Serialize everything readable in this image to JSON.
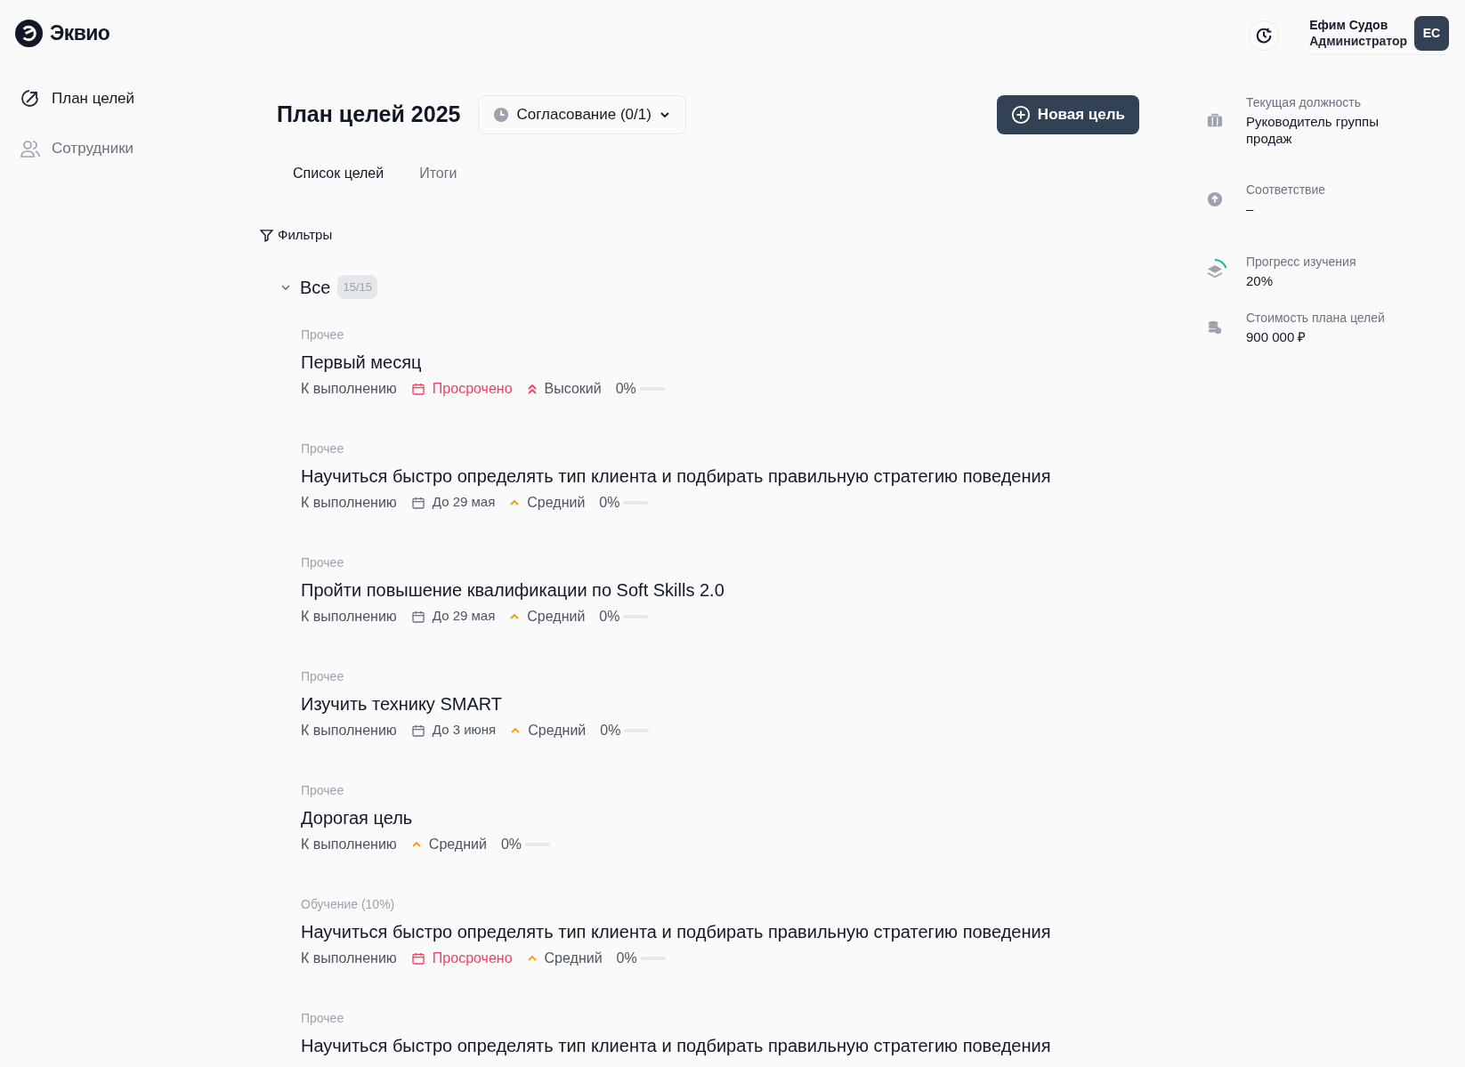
{
  "logo": {
    "text": "Эквио"
  },
  "sidebar": {
    "items": [
      {
        "label": "План целей",
        "selected": true,
        "kind": "goals"
      },
      {
        "label": "Сотрудники",
        "selected": false,
        "kind": "people"
      }
    ]
  },
  "user": {
    "name": "Ефим Судов",
    "role": "Администратор",
    "initials": "ЕС"
  },
  "page": {
    "title": "План целей 2025",
    "approval": "Согласование (0/1)",
    "new_button": "Новая цель"
  },
  "tabs": [
    {
      "label": "Список целей",
      "selected": true
    },
    {
      "label": "Итоги",
      "selected": false
    }
  ],
  "filters": "Фильтры",
  "group": {
    "label": "Все",
    "count": "15/15",
    "expanded": true
  },
  "goals": [
    {
      "category": "Прочее",
      "title": "Первый месяц",
      "status": "К выполнению",
      "deadline": {
        "text": "Просрочено",
        "overdue": true
      },
      "priority": {
        "label": "Высокий",
        "kind": "high"
      },
      "progress": "0%",
      "level": 0
    },
    {
      "category": "Прочее",
      "title": "Научиться быстро определять тип клиента и подбирать правильную стратегию поведения",
      "status": "К выполнению",
      "deadline": {
        "text": "До 29 мая",
        "overdue": false
      },
      "priority": {
        "label": "Средний",
        "kind": "medium"
      },
      "progress": "0%",
      "level": 0
    },
    {
      "category": "Прочее",
      "title": "Пройти повышение квалификации по Soft Skills 2.0",
      "status": "К выполнению",
      "deadline": {
        "text": "До 29 мая",
        "overdue": false
      },
      "priority": {
        "label": "Средний",
        "kind": "medium"
      },
      "progress": "0%",
      "level": 0
    },
    {
      "category": "Прочее",
      "title": "Изучить технику SMART",
      "status": "К выполнению",
      "deadline": {
        "text": "До 3 июня",
        "overdue": false
      },
      "priority": {
        "label": "Средний",
        "kind": "medium"
      },
      "progress": "0%",
      "level": 0
    },
    {
      "category": "Прочее",
      "title": "Дорогая цель",
      "status": "К выполнению",
      "priority": {
        "label": "Средний",
        "kind": "medium"
      },
      "progress": "0%",
      "level": 0
    },
    {
      "category": "Обучение (10%)",
      "title": "Научиться быстро определять тип клиента и подбирать правильную стратегию поведения",
      "status": "К выполнению",
      "deadline": {
        "text": "Просрочено",
        "overdue": true
      },
      "priority": {
        "label": "Средний",
        "kind": "medium"
      },
      "progress": "0%",
      "level": 0
    },
    {
      "category": "Прочее",
      "title": "Научиться быстро определять тип клиента и подбирать правильную стратегию поведения"
    }
  ],
  "summary": [
    {
      "kind": "position",
      "label": "Текущая должность",
      "value": "Руководитель группы продаж"
    },
    {
      "kind": "match",
      "label": "Соответствие",
      "value": "–"
    },
    {
      "kind": "learning",
      "label": "Прогресс изучения",
      "value": "20%",
      "level": 0.2
    },
    {
      "kind": "cost",
      "label": "Стоимость плана целей",
      "value": "900 000 ₽"
    }
  ]
}
